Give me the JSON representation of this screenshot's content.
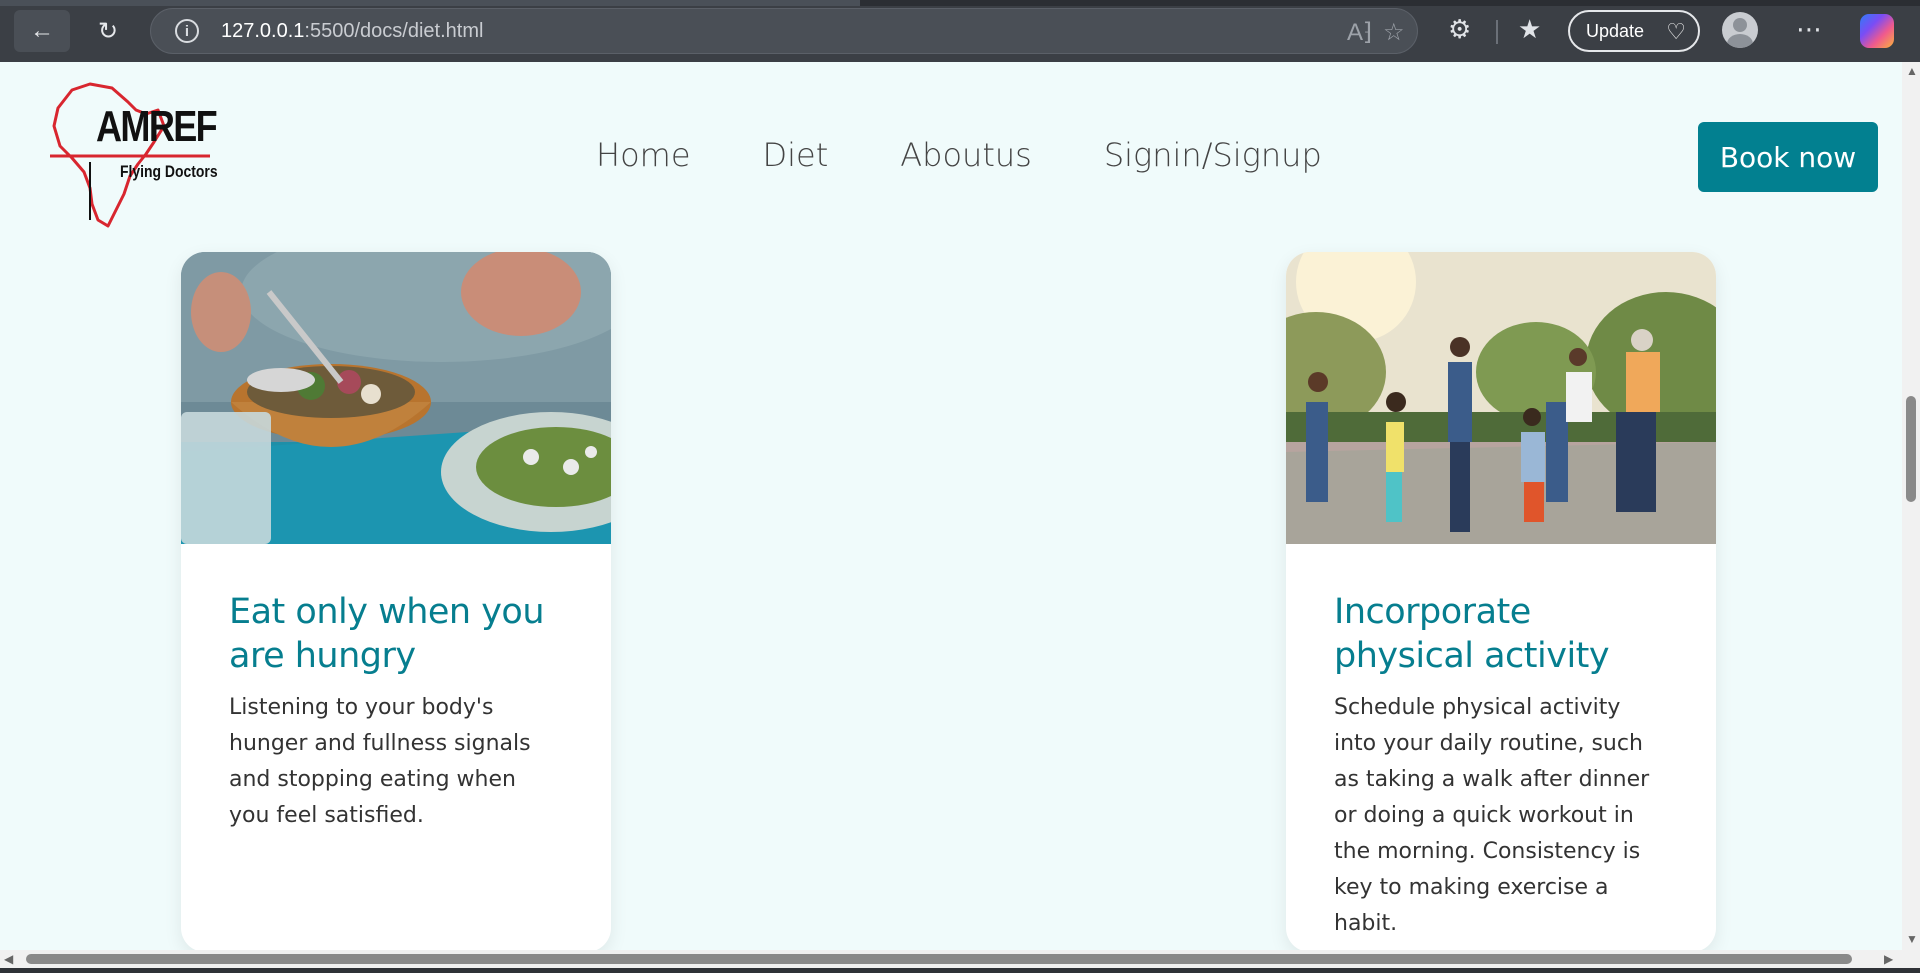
{
  "browser": {
    "url_host": "127.0.0.1",
    "url_path": ":5500/docs/diet.html",
    "update_label": "Update"
  },
  "site": {
    "logo_title": "AMREF",
    "logo_subtitle": "Flying Doctors",
    "nav": [
      "Home",
      "Diet",
      "Aboutus",
      "Signin/Signup"
    ],
    "book_label": "Book now"
  },
  "cards": [
    {
      "title": "Eat only when you are hungry",
      "text": "Listening to your body's hunger and fullness signals and stopping eating when you feel satisfied."
    },
    {
      "title": "Incorporate physical activity",
      "text": "Schedule physical activity into your daily routine, such as taking a walk after dinner or doing a quick workout in the morning. Consistency is key to making exercise a habit."
    }
  ],
  "colors": {
    "accent": "#028090",
    "heading": "#067e8f",
    "page_bg": "#f0fbfb"
  }
}
